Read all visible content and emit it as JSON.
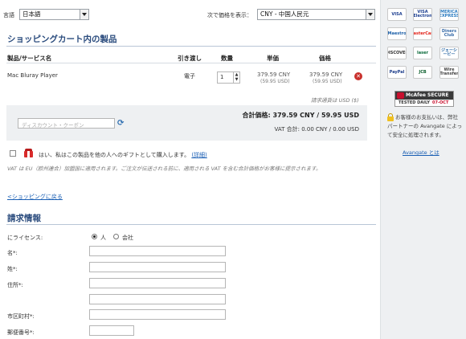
{
  "top": {
    "language_label": "言語",
    "language_value": "日本語",
    "price_label": "次で価格を表示：",
    "currency_value": "CNY - 中国人民元"
  },
  "cart": {
    "title": "ショッピングカート内の製品",
    "columns": {
      "product": "製品/サービス名",
      "delivery": "引き渡し",
      "qty": "数量",
      "unit": "単価",
      "price": "価格"
    },
    "item": {
      "name": "Mac Bluray Player",
      "delivery": "電子",
      "qty": "1",
      "unit_price": "379.59 CNY",
      "unit_price_usd": "(59.95 USD)",
      "price": "379.59 CNY",
      "price_usd": "(59.95 USD)"
    },
    "billing_currency": "請求通貨は USD ($)",
    "discount_placeholder": "ディスカウント・クーポン",
    "total": "合計価格: 379.59 CNY / 59.95 USD",
    "vat_total": "VAT 合計: 0.00 CNY / 0.00 USD",
    "gift_text": "はい、私はこの製品を他の人へのギフトとして購入します。",
    "gift_details_link": "(詳細)",
    "vat_note": "VAT は EU（欧州連合）加盟国に適用されます。ご注文が伝送される前に、適用される VAT を含む合計価格がお客様に提示されます。",
    "back_link": "<ショッピングに戻る"
  },
  "billing": {
    "title": "請求情報",
    "license_label": "にライセンス:",
    "option_person": "人",
    "option_company": "会社",
    "first_name_label": "名*:",
    "last_name_label": "姓*:",
    "address_label": "住所*:",
    "city_label": "市区町村*:",
    "zip_label": "郵便番号*:"
  },
  "sidebar": {
    "cards": [
      {
        "name": "VISA",
        "color": "#1a3d8f"
      },
      {
        "name": "VISA Electron",
        "color": "#1a3d8f"
      },
      {
        "name": "AMERICAN EXPRESS",
        "color": "#2a7bc0"
      },
      {
        "name": "Maestro",
        "color": "#1c5fa8"
      },
      {
        "name": "MasterCard",
        "color": "#e2231a"
      },
      {
        "name": "Diners Club",
        "color": "#3a6ca8"
      },
      {
        "name": "DISCOVER",
        "color": "#333"
      },
      {
        "name": "laser",
        "color": "#0a6a3a"
      },
      {
        "name": "ジェーシービー",
        "color": "#1d5fa0"
      },
      {
        "name": "PayPal",
        "color": "#1a3b8a"
      },
      {
        "name": "JCB",
        "color": "#0a5e2b"
      },
      {
        "name": "Wire Transfer",
        "color": "#444"
      }
    ],
    "mcafee_title": "McAfee SECURE",
    "mcafee_sub": "TESTED DAILY",
    "mcafee_date": "07-OCT",
    "security_text": "お客様のお支払いは、弊社パートナーの Avangate によって安全に処理されます。",
    "avangate_link": "Avangate とは"
  }
}
